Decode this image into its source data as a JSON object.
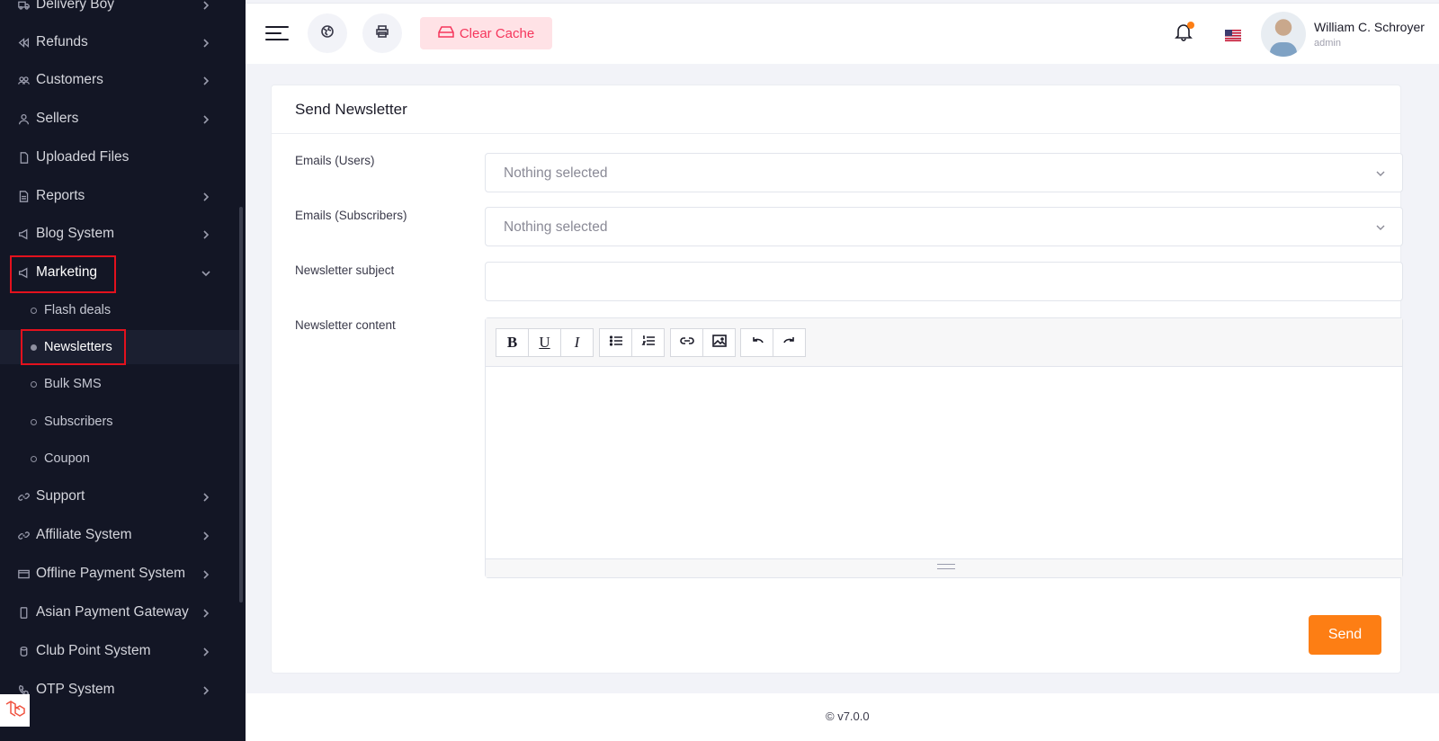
{
  "sidebar": {
    "items": [
      {
        "label": "Delivery Boy",
        "icon": "truck-icon"
      },
      {
        "label": "Refunds",
        "icon": "backward-icon"
      },
      {
        "label": "Customers",
        "icon": "users-icon"
      },
      {
        "label": "Sellers",
        "icon": "user-icon"
      },
      {
        "label": "Uploaded Files",
        "icon": "file-icon"
      },
      {
        "label": "Reports",
        "icon": "report-icon"
      },
      {
        "label": "Blog System",
        "icon": "megaphone-icon"
      },
      {
        "label": "Marketing",
        "icon": "megaphone-icon"
      },
      {
        "label": "Support",
        "icon": "link-icon"
      },
      {
        "label": "Affiliate System",
        "icon": "link-icon"
      },
      {
        "label": "Offline Payment System",
        "icon": "card-icon"
      },
      {
        "label": "Asian Payment Gateway",
        "icon": "phone-icon"
      },
      {
        "label": "Club Point System",
        "icon": "coin-icon"
      },
      {
        "label": "OTP System",
        "icon": "phone-call-icon"
      }
    ],
    "marketing_sub": [
      {
        "label": "Flash deals"
      },
      {
        "label": "Newsletters"
      },
      {
        "label": "Bulk SMS"
      },
      {
        "label": "Subscribers"
      },
      {
        "label": "Coupon"
      }
    ]
  },
  "topbar": {
    "clear_cache_label": "Clear Cache",
    "user_name": "William C. Schroyer",
    "user_role": "admin"
  },
  "form": {
    "title": "Send Newsletter",
    "emails_users_label": "Emails (Users)",
    "emails_users_placeholder": "Nothing selected",
    "emails_subscribers_label": "Emails (Subscribers)",
    "emails_subscribers_placeholder": "Nothing selected",
    "subject_label": "Newsletter subject",
    "subject_value": "",
    "content_label": "Newsletter content",
    "send_label": "Send"
  },
  "footer": {
    "version": "© v7.0.0"
  },
  "colors": {
    "accent": "#fd7e14",
    "sidebar_bg": "#131625",
    "danger": "#f5365c"
  }
}
